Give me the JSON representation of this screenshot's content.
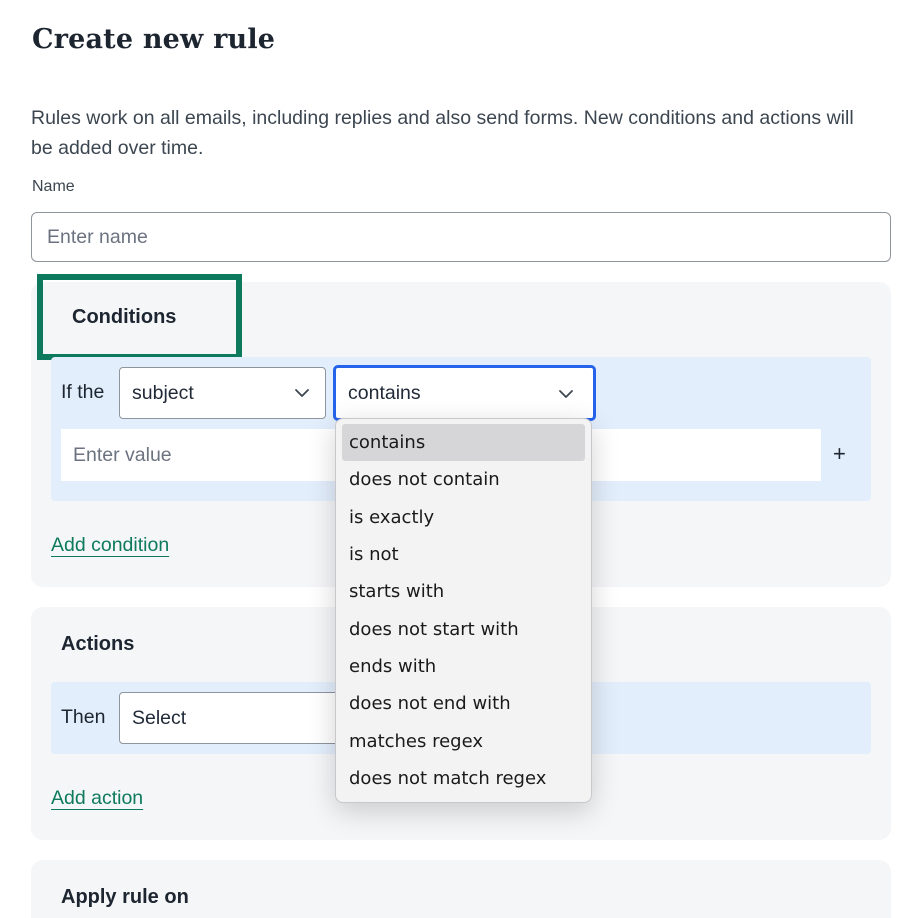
{
  "page": {
    "title": "Create new rule",
    "intro": "Rules work on all emails, including replies and also send forms. New conditions and actions will be added over time."
  },
  "name_field": {
    "label": "Name",
    "placeholder": "Enter name",
    "value": ""
  },
  "conditions": {
    "title": "Conditions",
    "if_label": "If the",
    "field_select": "subject",
    "operator_select": "contains",
    "value_placeholder": "Enter value",
    "plus_label": "+",
    "add_link": "Add condition"
  },
  "operator_dropdown": {
    "selected": "contains",
    "options": [
      "contains",
      "does not contain",
      "is exactly",
      "is not",
      "starts with",
      "does not start with",
      "ends with",
      "does not end with",
      "matches regex",
      "does not match regex"
    ]
  },
  "actions": {
    "title": "Actions",
    "then_label": "Then",
    "select_placeholder": "Select",
    "add_link": "Add action"
  },
  "apply": {
    "title": "Apply rule on"
  },
  "colors": {
    "accent_green": "#0e7a5d",
    "focus_blue": "#2563eb",
    "row_bg": "#e3eefc",
    "panel_bg": "#f5f6f8"
  },
  "icons": {
    "select_chevron": "chevron-down-icon",
    "add_value": "plus-icon"
  }
}
